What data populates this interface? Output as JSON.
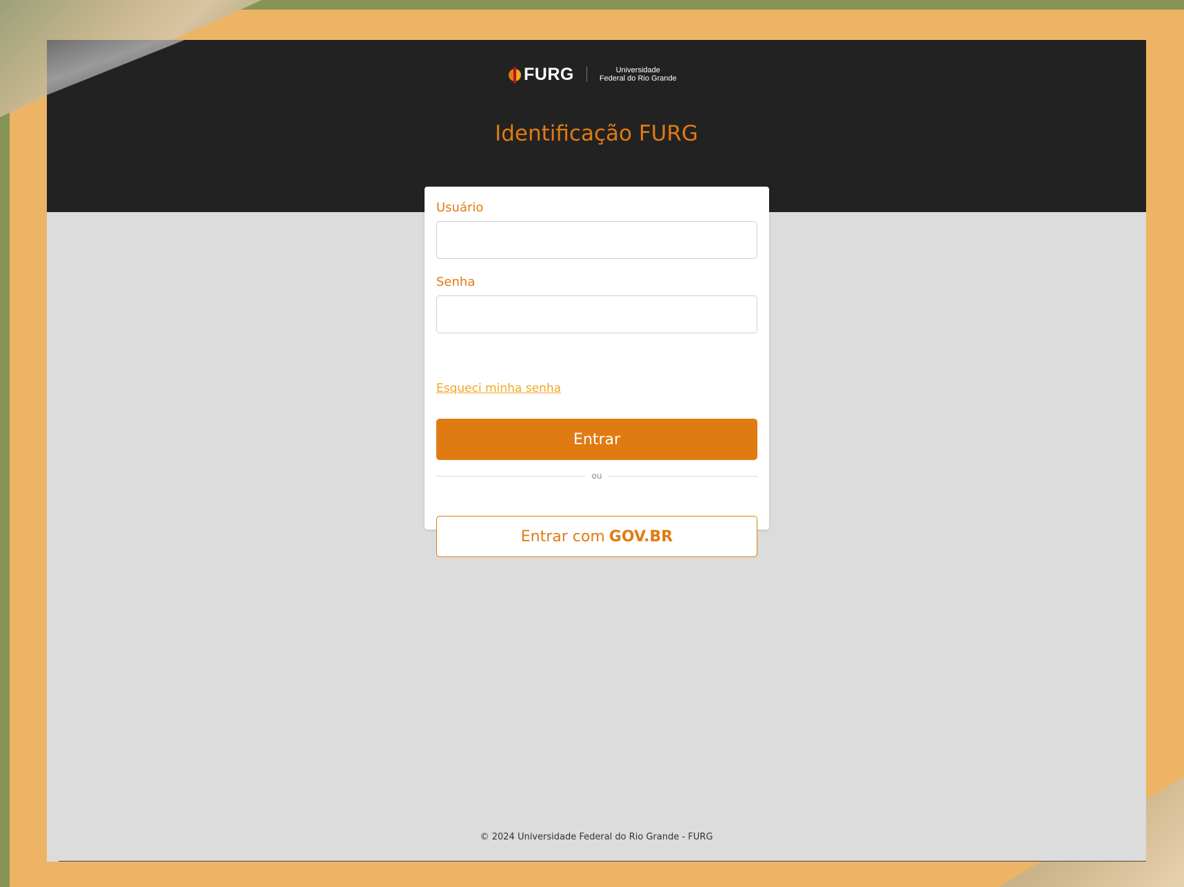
{
  "header": {
    "logo_text": "FURG",
    "logo_sub_line1": "Universidade",
    "logo_sub_line2": "Federal do Rio Grande",
    "title": "Identificação FURG"
  },
  "form": {
    "username_label": "Usuário",
    "username_value": "",
    "password_label": "Senha",
    "password_value": "",
    "forgot_link": "Esqueci minha senha",
    "submit_label": "Entrar",
    "divider_text": "ou",
    "govbr_prefix": "Entrar com",
    "govbr_brand": "GOV.BR"
  },
  "footer": {
    "copyright": "© 2024 Universidade Federal do Rio Grande - FURG"
  },
  "colors": {
    "accent": "#e07b12",
    "link": "#f2a623",
    "header_bg": "#222222",
    "page_bg": "#dcdcdc",
    "frame_orange": "#eeb465",
    "frame_green": "#869556"
  }
}
